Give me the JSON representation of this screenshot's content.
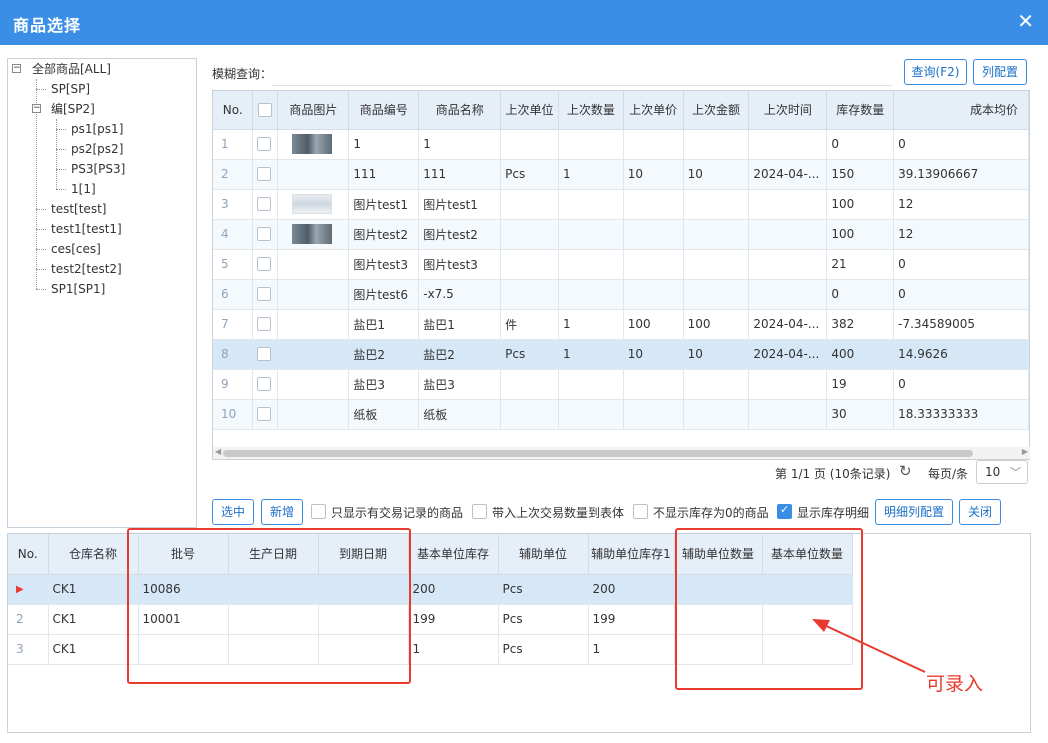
{
  "window": {
    "title": "商品选择",
    "close_icon": "close-icon"
  },
  "tree": {
    "items": [
      {
        "label": "全部商品[ALL]"
      },
      {
        "label": "SP[SP]"
      },
      {
        "label": "编[SP2]"
      },
      {
        "label": "ps1[ps1]"
      },
      {
        "label": "ps2[ps2]"
      },
      {
        "label": "PS3[PS3]"
      },
      {
        "label": "1[1]"
      },
      {
        "label": "test[test]"
      },
      {
        "label": "test1[test1]"
      },
      {
        "label": "ces[ces]"
      },
      {
        "label": "test2[test2]"
      },
      {
        "label": "SP1[SP1]"
      }
    ]
  },
  "search": {
    "label": "模糊查询："
  },
  "buttons": {
    "query": "查询(F2)",
    "column_config": "列配置",
    "select": "选中",
    "add": "新增",
    "detail_column_config": "明细列配置",
    "close": "关闭"
  },
  "goods_grid": {
    "columns": [
      "No.",
      "",
      "商品图片",
      "商品编号",
      "商品名称",
      "上次单位",
      "上次数量",
      "上次单价",
      "上次金额",
      "上次时间",
      "库存数量",
      "成本均价"
    ],
    "rows": [
      {
        "no": "1",
        "image": "photo",
        "code": "1",
        "name": "1",
        "unit": "",
        "qty": "",
        "price": "",
        "amount": "",
        "time": "",
        "stock": "0",
        "cost": "0"
      },
      {
        "no": "2",
        "image": "",
        "code": "111",
        "name": "111",
        "unit": "Pcs",
        "qty": "1",
        "price": "10",
        "amount": "10",
        "time": "2024-04-...",
        "stock": "150",
        "cost": "39.13906667"
      },
      {
        "no": "3",
        "image": "screenshot",
        "code": "图片test1",
        "name": "图片test1",
        "unit": "",
        "qty": "",
        "price": "",
        "amount": "",
        "time": "",
        "stock": "100",
        "cost": "12"
      },
      {
        "no": "4",
        "image": "photo",
        "code": "图片test2",
        "name": "图片test2",
        "unit": "",
        "qty": "",
        "price": "",
        "amount": "",
        "time": "",
        "stock": "100",
        "cost": "12"
      },
      {
        "no": "5",
        "image": "",
        "code": "图片test3",
        "name": "图片test3",
        "unit": "",
        "qty": "",
        "price": "",
        "amount": "",
        "time": "",
        "stock": "21",
        "cost": "0"
      },
      {
        "no": "6",
        "image": "",
        "code": "图片test6",
        "name": "-x7.5",
        "unit": "",
        "qty": "",
        "price": "",
        "amount": "",
        "time": "",
        "stock": "0",
        "cost": "0"
      },
      {
        "no": "7",
        "image": "",
        "code": "盐巴1",
        "name": "盐巴1",
        "unit": "件",
        "qty": "1",
        "price": "100",
        "amount": "100",
        "time": "2024-04-...",
        "stock": "382",
        "cost": "-7.34589005"
      },
      {
        "no": "8",
        "image": "",
        "code": "盐巴2",
        "name": "盐巴2",
        "unit": "Pcs",
        "qty": "1",
        "price": "10",
        "amount": "10",
        "time": "2024-04-...",
        "stock": "400",
        "cost": "14.9626"
      },
      {
        "no": "9",
        "image": "",
        "code": "盐巴3",
        "name": "盐巴3",
        "unit": "",
        "qty": "",
        "price": "",
        "amount": "",
        "time": "",
        "stock": "19",
        "cost": "0"
      },
      {
        "no": "10",
        "image": "",
        "code": "纸板",
        "name": "纸板",
        "unit": "",
        "qty": "",
        "price": "",
        "amount": "",
        "time": "",
        "stock": "30",
        "cost": "18.33333333"
      }
    ]
  },
  "pager": {
    "text": "第 1/1 页 (10条记录)",
    "per_page_label": "每页/条",
    "per_page_value": "10"
  },
  "options": [
    {
      "label": "只显示有交易记录的商品",
      "checked": false
    },
    {
      "label": "带入上次交易数量到表体",
      "checked": false
    },
    {
      "label": "不显示库存为0的商品",
      "checked": false
    },
    {
      "label": "显示库存明细",
      "checked": true
    }
  ],
  "stock_grid": {
    "columns": [
      "No.",
      "仓库名称",
      "批号",
      "生产日期",
      "到期日期",
      "基本单位库存",
      "辅助单位",
      "辅助单位库存1",
      "辅助单位数量",
      "基本单位数量"
    ],
    "rows": [
      {
        "no": "▶",
        "warehouse": "CK1",
        "batch": "10086",
        "mfg": "",
        "exp": "",
        "base_stock": "200",
        "aux_unit": "Pcs",
        "aux_stock": "200",
        "aux_qty": "",
        "base_qty": ""
      },
      {
        "no": "2",
        "warehouse": "CK1",
        "batch": "10001",
        "mfg": "",
        "exp": "",
        "base_stock": "199",
        "aux_unit": "Pcs",
        "aux_stock": "199",
        "aux_qty": "",
        "base_qty": ""
      },
      {
        "no": "3",
        "warehouse": "CK1",
        "batch": "",
        "mfg": "",
        "exp": "",
        "base_stock": "1",
        "aux_unit": "Pcs",
        "aux_stock": "1",
        "aux_qty": "",
        "base_qty": ""
      }
    ]
  },
  "annotation": {
    "text": "可录入",
    "color": "#e83a2e"
  },
  "colors": {
    "titlebar": "#3a8ee6",
    "header": "#e6eef8",
    "selected_row": "#d6e8f8"
  }
}
